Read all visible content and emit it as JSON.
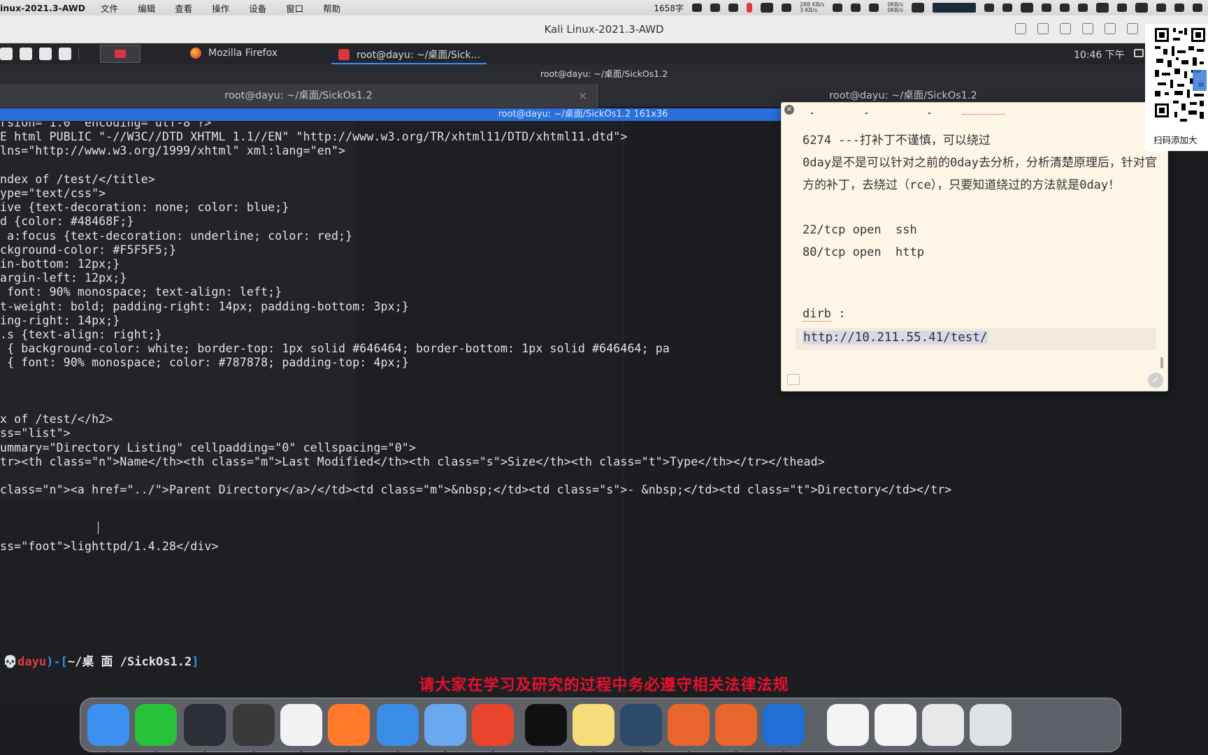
{
  "menubar": {
    "app_name": "inux-2021.3-AWD",
    "items": [
      "文件",
      "编辑",
      "查看",
      "操作",
      "设备",
      "窗口",
      "帮助"
    ],
    "wordcount": "1658字",
    "net_up": "288 KB/s",
    "net_down": "3 KB/s",
    "net2_up": "0KB/s",
    "net2_down": "0KB/s"
  },
  "vm_window": {
    "title": "Kali Linux-2021.3-AWD"
  },
  "kali_panel": {
    "tasks": [
      {
        "label": "Mozilla Firefox"
      },
      {
        "label": "root@dayu: ~/桌面/Sick..."
      }
    ],
    "clock": "10:46 下午"
  },
  "terminal": {
    "window_title": "root@dayu: ~/桌面/SickOs1.2",
    "tabs": [
      {
        "label": "root@dayu: ~/桌面/SickOs1.2",
        "close": "×"
      },
      {
        "label": "root@dayu: ~/桌面/SickOs1.2"
      }
    ],
    "pane_title": "root@dayu: ~/桌面/SickOs1.2 161x36",
    "lines": [
      "rsion=\"1.0\" encoding=\"utf-8\"?>",
      "E html PUBLIC \"-//W3C//DTD XHTML 1.1//EN\" \"http://www.w3.org/TR/xhtml11/DTD/xhtml11.dtd\">",
      "lns=\"http://www.w3.org/1999/xhtml\" xml:lang=\"en\">",
      "",
      "ndex of /test/</title>",
      "ype=\"text/css\">",
      "ive {text-decoration: none; color: blue;}",
      "d {color: #48468F;}",
      " a:focus {text-decoration: underline; color: red;}",
      "ckground-color: #F5F5F5;}",
      "in-bottom: 12px;}",
      "argin-left: 12px;}",
      " font: 90% monospace; text-align: left;}",
      "t-weight: bold; padding-right: 14px; padding-bottom: 3px;}",
      "ing-right: 14px;}",
      ".s {text-align: right;}",
      " { background-color: white; border-top: 1px solid #646464; border-bottom: 1px solid #646464; pa",
      " { font: 90% monospace; color: #787878; padding-top: 4px;}",
      "",
      "",
      "",
      "x of /test/</h2>",
      "ss=\"list\">",
      "ummary=\"Directory Listing\" cellpadding=\"0\" cellspacing=\"0\">",
      "tr><th class=\"n\">Name</th><th class=\"m\">Last Modified</th><th class=\"s\">Size</th><th class=\"t\">Type</th></tr></thead>",
      "",
      "class=\"n\"><a href=\"../\">Parent Directory</a>/</td><td class=\"m\">&nbsp;</td><td class=\"s\">- &nbsp;</td><td class=\"t\">Directory</td></tr>",
      "",
      "",
      "",
      "ss=\"foot\">lighttpd/1.4.28</div>"
    ],
    "prompt": {
      "skull": "💀",
      "user": "dayu",
      "sep": ")-[",
      "path": "~/桌 面 /SickOs1.2",
      "close": "]"
    }
  },
  "sticky_note": {
    "close": "×",
    "lines": [
      "6274 ---打补丁不谨慎，可以绕过",
      "0day是不是可以针对之前的0day去分析，分析清楚原理后，针对官方的补丁，去绕过（rce），只要知道绕过的方法就是0day！",
      "",
      "22/tcp open  ssh",
      "80/tcp open  http"
    ],
    "dirb_label": "dirb",
    "dirb_colon": " :",
    "url": "http://10.211.55.41/test/",
    "check": "✓"
  },
  "qr": {
    "caption": "扫码添加大"
  },
  "warning_banner": "请大家在学习及研究的过程中务必遵守相关法律法规",
  "dock": {
    "apps": [
      {
        "icon": "finder-icon",
        "color": "#3d8ff0"
      },
      {
        "icon": "wechat-icon",
        "color": "#27c13a"
      },
      {
        "icon": "activity-monitor-icon",
        "color": "#2d2f36"
      },
      {
        "icon": "sublime-text-icon",
        "color": "#3a3a3a"
      },
      {
        "icon": "chrome-icon",
        "color": "#f2f2f2"
      },
      {
        "icon": "firefox-icon",
        "color": "#ff7a2a"
      },
      {
        "icon": "parallels-icon",
        "color": "#3b8ee8"
      },
      {
        "icon": "vm-screen-icon",
        "color": "#6aa8f0"
      },
      {
        "icon": "xmind-icon",
        "color": "#e8452c"
      },
      {
        "icon": "terminal-icon",
        "color": "#111111"
      },
      {
        "icon": "notes-icon",
        "color": "#f6dc7a"
      },
      {
        "icon": "kali-icon",
        "color": "#2c4a6a"
      },
      {
        "icon": "ubuntu-icon",
        "color": "#e8662c"
      },
      {
        "icon": "ubuntu2-icon",
        "color": "#e8662c"
      },
      {
        "icon": "wireshark-icon",
        "color": "#1f6fd6"
      },
      {
        "icon": "doc-window-icon-1",
        "color": "#f4f4f4"
      },
      {
        "icon": "doc-window-icon-2",
        "color": "#f4f4f4"
      },
      {
        "icon": "doc-window-icon-3",
        "color": "#e8e8e8"
      },
      {
        "icon": "trash-icon",
        "color": "#dfe3e8"
      }
    ]
  },
  "colors": {
    "terminal_bg": "#1d1f23",
    "pane_bar": "#2a6fdb",
    "prompt_user": "#e23d3d",
    "prompt_bracket": "#3b8ee8",
    "warning": "#e8102c",
    "note_bg": "#fdf6e7"
  }
}
